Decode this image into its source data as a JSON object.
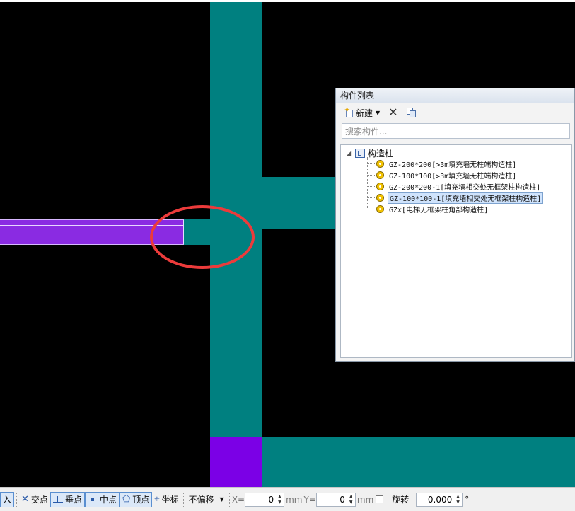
{
  "panel": {
    "title": "构件列表",
    "toolbar": {
      "new_label": "新建",
      "new_icon": "new-component-icon",
      "delete_icon": "delete-icon",
      "copy_icon": "copy-icon"
    },
    "search": {
      "placeholder": "搜索构件..."
    },
    "tree": {
      "root_label": "构造柱",
      "items": [
        {
          "label": "GZ-200*200[>3m填充墙无柱端构造柱]",
          "selected": false
        },
        {
          "label": "GZ-100*100[>3m填充墙无柱端构造柱]",
          "selected": false
        },
        {
          "label": "GZ-200*200-1[填充墙相交处无框架柱构造柱]",
          "selected": false
        },
        {
          "label": "GZ-100*100-1[填充墙相交处无框架柱构造柱]",
          "selected": true
        },
        {
          "label": "GZx[电梯无框架柱角部构造柱]",
          "selected": false
        }
      ]
    }
  },
  "statusbar": {
    "cut_label": "入",
    "intersection_label": "交点",
    "perpendicular_label": "垂点",
    "midpoint_label": "中点",
    "vertex_label": "顶点",
    "coordinate_label": "坐标",
    "offset_mode": "不偏移",
    "x_label": "X=",
    "x_value": "0",
    "x_unit": "mm",
    "y_label": "Y=",
    "y_value": "0",
    "y_unit": "mm",
    "rotate_label": "旋转",
    "rotate_value": "0.000",
    "degree_symbol": "°"
  },
  "colors": {
    "canvas_bg": "#000000",
    "column_teal": "#008080",
    "wall_purple": "#8a2be2",
    "annotation_red": "#ec3b3b"
  }
}
